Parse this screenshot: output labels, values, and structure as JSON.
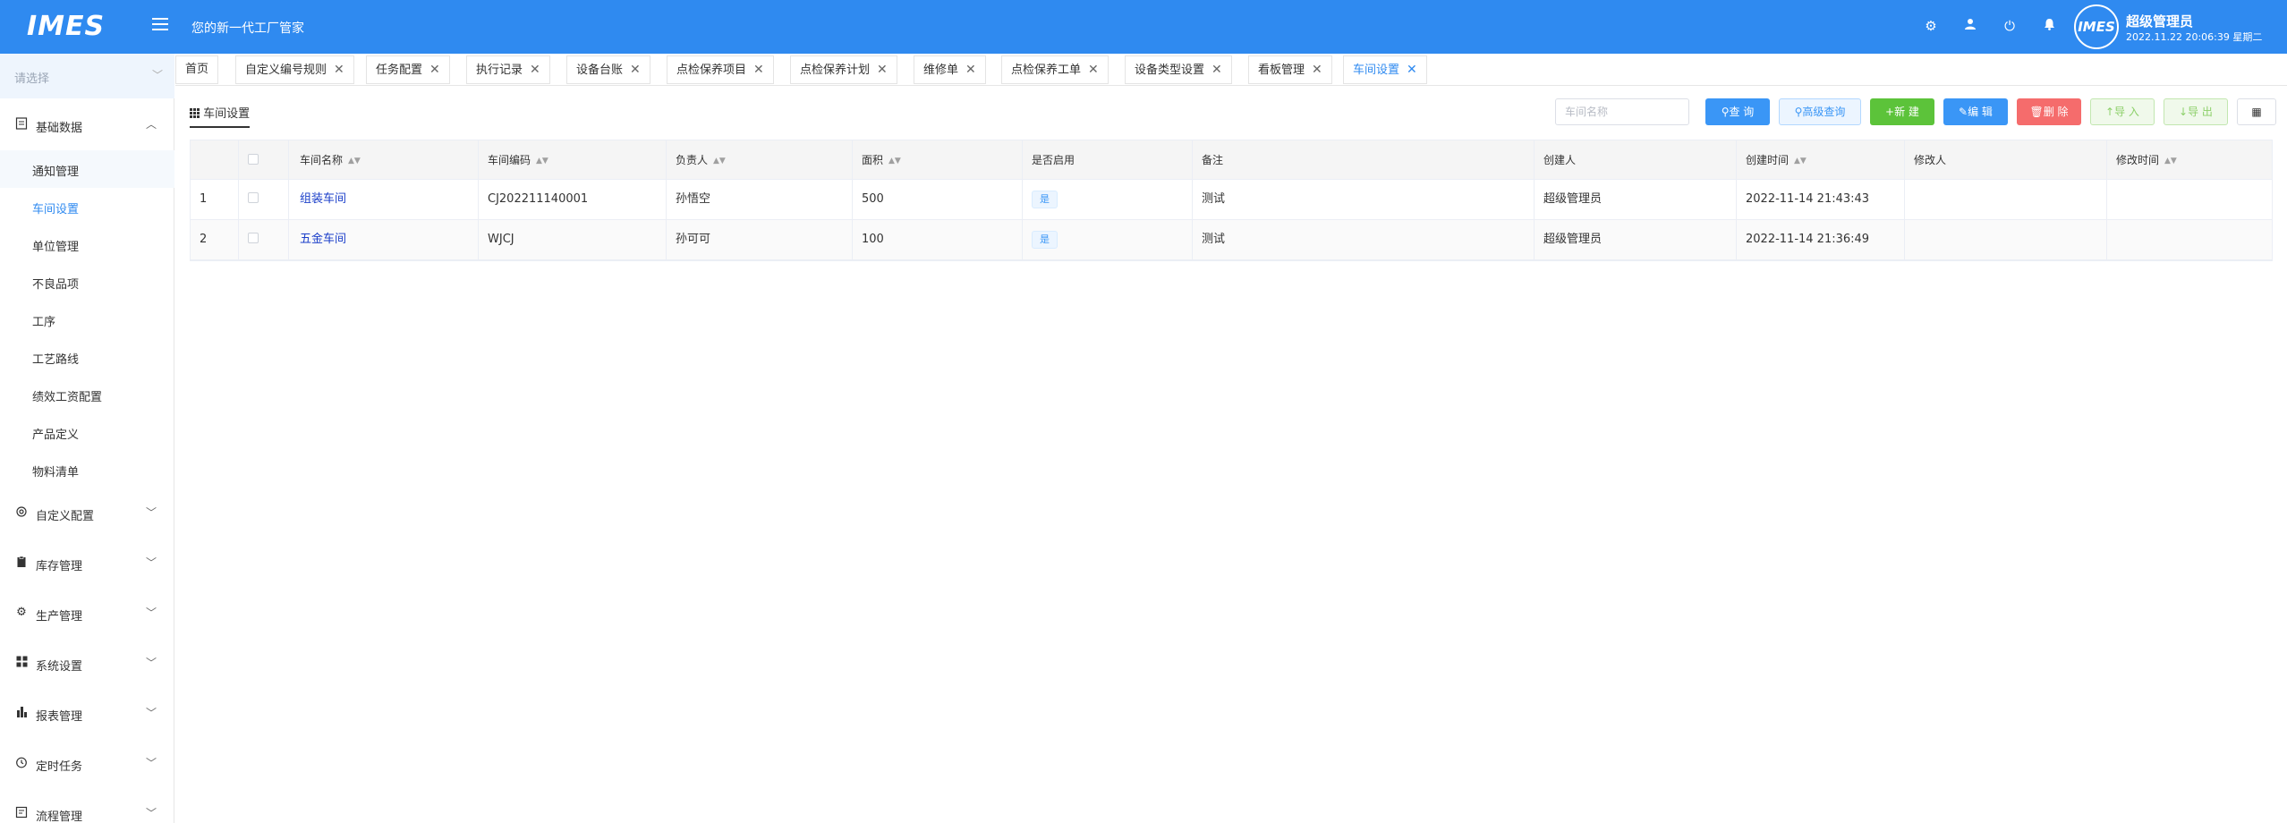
{
  "header": {
    "logo": "IMES",
    "slogan": "您的新一代工厂管家",
    "user_name": "超级管理员",
    "datetime": "2022.11.22 20:06:39 星期二",
    "avatar_text": "IMES"
  },
  "sidebar": {
    "select_placeholder": "请选择",
    "groups": [
      {
        "label": "基础数据",
        "icon": "doc-icon",
        "expanded": true
      },
      {
        "label": "自定义配置",
        "icon": "cog-outline-icon"
      },
      {
        "label": "库存管理",
        "icon": "clipboard-icon"
      },
      {
        "label": "生产管理",
        "icon": "gear-icon"
      },
      {
        "label": "系统设置",
        "icon": "grid-icon"
      },
      {
        "label": "报表管理",
        "icon": "bar-chart-icon"
      },
      {
        "label": "定时任务",
        "icon": "clock-icon"
      },
      {
        "label": "流程管理",
        "icon": "flow-icon"
      }
    ],
    "items": [
      {
        "label": "通知管理"
      },
      {
        "label": "车间设置"
      },
      {
        "label": "单位管理"
      },
      {
        "label": "不良品项"
      },
      {
        "label": "工序"
      },
      {
        "label": "工艺路线"
      },
      {
        "label": "绩效工资配置"
      },
      {
        "label": "产品定义"
      },
      {
        "label": "物料清单"
      }
    ]
  },
  "tabs": [
    {
      "label": "首页"
    },
    {
      "label": "自定义编号规则"
    },
    {
      "label": "任务配置"
    },
    {
      "label": "执行记录"
    },
    {
      "label": "设备台账"
    },
    {
      "label": "点检保养项目"
    },
    {
      "label": "点检保养计划"
    },
    {
      "label": "维修单"
    },
    {
      "label": "点检保养工单"
    },
    {
      "label": "设备类型设置"
    },
    {
      "label": "看板管理"
    },
    {
      "label": "车间设置"
    }
  ],
  "toolbar": {
    "page_title": "车间设置",
    "search_placeholder": "车间名称",
    "query": "查 询",
    "advanced": "高级查询",
    "create": "新 建",
    "edit": "编 辑",
    "delete": "删 除",
    "import": "导 入",
    "export": "导 出"
  },
  "table": {
    "columns": [
      "车间名称",
      "车间编码",
      "负责人",
      "面积",
      "是否启用",
      "备注",
      "创建人",
      "创建时间",
      "修改人",
      "修改时间"
    ],
    "rows": [
      {
        "index": "1",
        "name": "组装车间",
        "code": "CJ202211140001",
        "owner": "孙悟空",
        "area": "500",
        "enabled": "是",
        "remark": "测试",
        "creator": "超级管理员",
        "created": "2022-11-14 21:43:43",
        "modifier": "",
        "modified": ""
      },
      {
        "index": "2",
        "name": "五金车间",
        "code": "WJCJ",
        "owner": "孙可可",
        "area": "100",
        "enabled": "是",
        "remark": "测试",
        "creator": "超级管理员",
        "created": "2022-11-14 21:36:49",
        "modifier": "",
        "modified": ""
      }
    ]
  }
}
